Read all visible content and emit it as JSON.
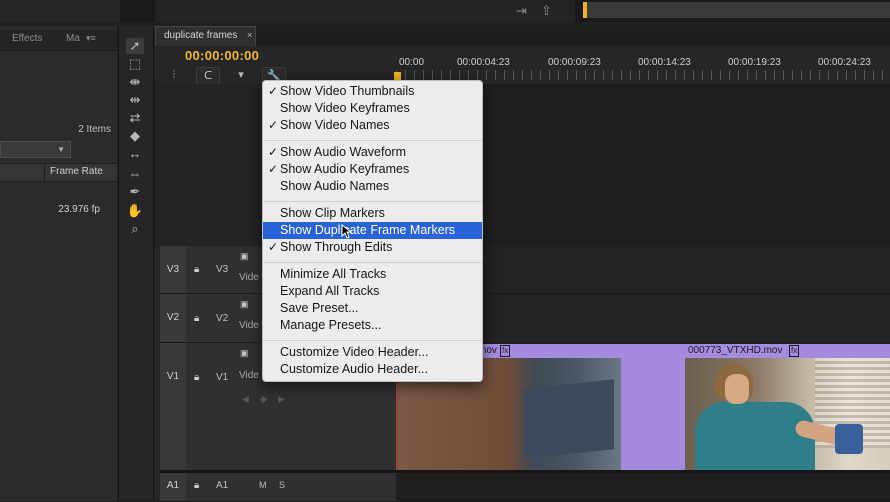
{
  "top": {
    "icons": [
      "export-frame-icon",
      "share-icon"
    ]
  },
  "project_panel": {
    "tabs": [
      "Effects",
      "Ma"
    ],
    "items_count": "2 Items",
    "column_header": "Frame Rate",
    "frame_rate_value": "23.976 fp"
  },
  "sequence": {
    "tab_label": "duplicate frames",
    "close_glyph": "×",
    "timecode": "00:00:00:00",
    "ruler_labels": [
      "00:00",
      "00:00:04:23",
      "00:00:09:23",
      "00:00:14:23",
      "00:00:19:23",
      "00:00:24:23"
    ]
  },
  "tracks": [
    {
      "patch": "V3",
      "name": "V3",
      "label": "Vide"
    },
    {
      "patch": "V2",
      "name": "V2",
      "label": "Vide"
    },
    {
      "patch": "V1",
      "name": "V1",
      "label": "Vide"
    },
    {
      "patch": "A1",
      "name": "A1",
      "m": "M",
      "s": "S"
    }
  ],
  "clips": [
    {
      "name": "mov",
      "fx": "fx"
    },
    {
      "name": "000773_VTXHD.mov",
      "fx": "fx"
    }
  ],
  "colors": {
    "accent": "#f2b82e",
    "clip": "#a58be0",
    "menu_highlight": "#2a63d8"
  },
  "context_menu": {
    "groups": [
      [
        {
          "label": "Show Video Thumbnails",
          "checked": true
        },
        {
          "label": "Show Video Keyframes",
          "checked": false
        },
        {
          "label": "Show Video Names",
          "checked": true
        }
      ],
      [
        {
          "label": "Show Audio Waveform",
          "checked": true
        },
        {
          "label": "Show Audio Keyframes",
          "checked": true
        },
        {
          "label": "Show Audio Names",
          "checked": false
        }
      ],
      [
        {
          "label": "Show Clip Markers",
          "checked": false
        },
        {
          "label": "Show Duplicate Frame Markers",
          "checked": false,
          "highlighted": true
        },
        {
          "label": "Show Through Edits",
          "checked": true
        }
      ],
      [
        {
          "label": "Minimize All Tracks",
          "checked": false
        },
        {
          "label": "Expand All Tracks",
          "checked": false
        },
        {
          "label": "Save Preset...",
          "checked": false
        },
        {
          "label": "Manage Presets...",
          "checked": false
        }
      ],
      [
        {
          "label": "Customize Video Header...",
          "checked": false
        },
        {
          "label": "Customize Audio Header...",
          "checked": false
        }
      ]
    ]
  }
}
